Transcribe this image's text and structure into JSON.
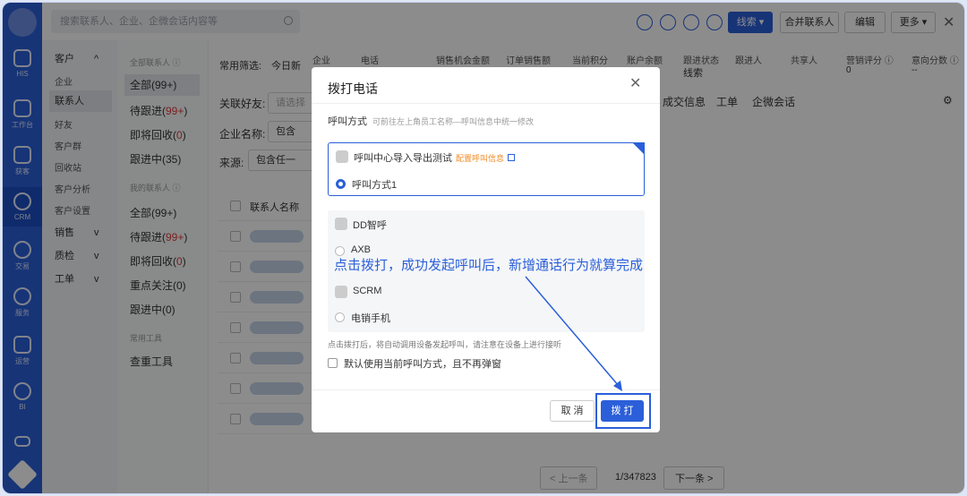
{
  "search": {
    "placeholder": "搜索联系人、企业、企微会话内容等"
  },
  "rail": {
    "items": [
      "HIS",
      "工作台",
      "获客",
      "CRM",
      "交易",
      "服务",
      "运营",
      "BI"
    ]
  },
  "nav_primary": {
    "items": [
      {
        "label": "客户",
        "arrow": "^"
      },
      {
        "label": "企业"
      },
      {
        "label": "联系人"
      },
      {
        "label": "好友"
      },
      {
        "label": "客户群"
      },
      {
        "label": "回收站"
      },
      {
        "label": "客户分析"
      },
      {
        "label": "客户设置"
      },
      {
        "label": "销售",
        "arrow": "v"
      },
      {
        "label": "质检",
        "arrow": "v"
      },
      {
        "label": "工单",
        "arrow": "v"
      }
    ]
  },
  "nav_secondary": {
    "group1": "全部联系人 ⓘ",
    "items1": [
      "全部(99+)",
      "待跟进(",
      "即将回收(",
      "跟进中(35)"
    ],
    "group2": "我的联系人 ⓘ",
    "items2": [
      "全部(99+)",
      "待跟进(",
      "即将回收(",
      "重点关注(0)",
      "跟进中(0)"
    ],
    "group3": "常用工具",
    "tool": "查重工具",
    "red_counts": [
      "99+",
      "0"
    ]
  },
  "filters": {
    "common": "常用筛选:",
    "today": "今日新",
    "friend_label": "关联好友:",
    "friend_placeholder": "请选择",
    "company_label": "企业名称:",
    "company_value": "包含",
    "source_label": "来源:",
    "source_value": "包含任一"
  },
  "table": {
    "header": "联系人名称"
  },
  "top_buttons": {
    "leads": "线索 ▾",
    "merge": "合并联系人",
    "edit": "编辑",
    "more": "更多 ▾"
  },
  "stats": {
    "labels": [
      "企业",
      "电话",
      "销售机会金额",
      "订单销售额",
      "当前积分",
      "账户余额",
      "跟进状态",
      "跟进人",
      "共享人",
      "营销评分 ⓘ",
      "意向分数 ⓘ"
    ],
    "follow_value": "线索",
    "score_value": "0",
    "intent_value": "--"
  },
  "tabs_right": [
    "成交信息",
    "工单",
    "企微会话"
  ],
  "pager": {
    "prev": "< 上一条",
    "count": "1/347823",
    "next": "下一条 >"
  },
  "dialog": {
    "title": "拨打电话",
    "section_label": "呼叫方式",
    "section_hint": "可前往左上角员工名称—呼叫信息中统一修改",
    "option1_title": "呼叫中心导入导出测试",
    "option1_config": "配置呼叫信息",
    "option1_sub": "呼叫方式1",
    "option2_title": "DD智呼",
    "option2_sub": "AXB",
    "option3_title": "SCRM",
    "option3_sub": "电销手机",
    "hint": "点击拨打后，将自动调用设备发起呼叫，请注意在设备上进行接听",
    "checkbox_label": "默认使用当前呼叫方式，且不再弹窗",
    "cancel": "取 消",
    "dial": "拨 打"
  },
  "annotation": "点击拨打，成功发起呼叫后，新增通话行为就算完成",
  "colors": {
    "accent": "#2b5fd9",
    "config": "#f08a24",
    "red": "#e23b3b"
  }
}
